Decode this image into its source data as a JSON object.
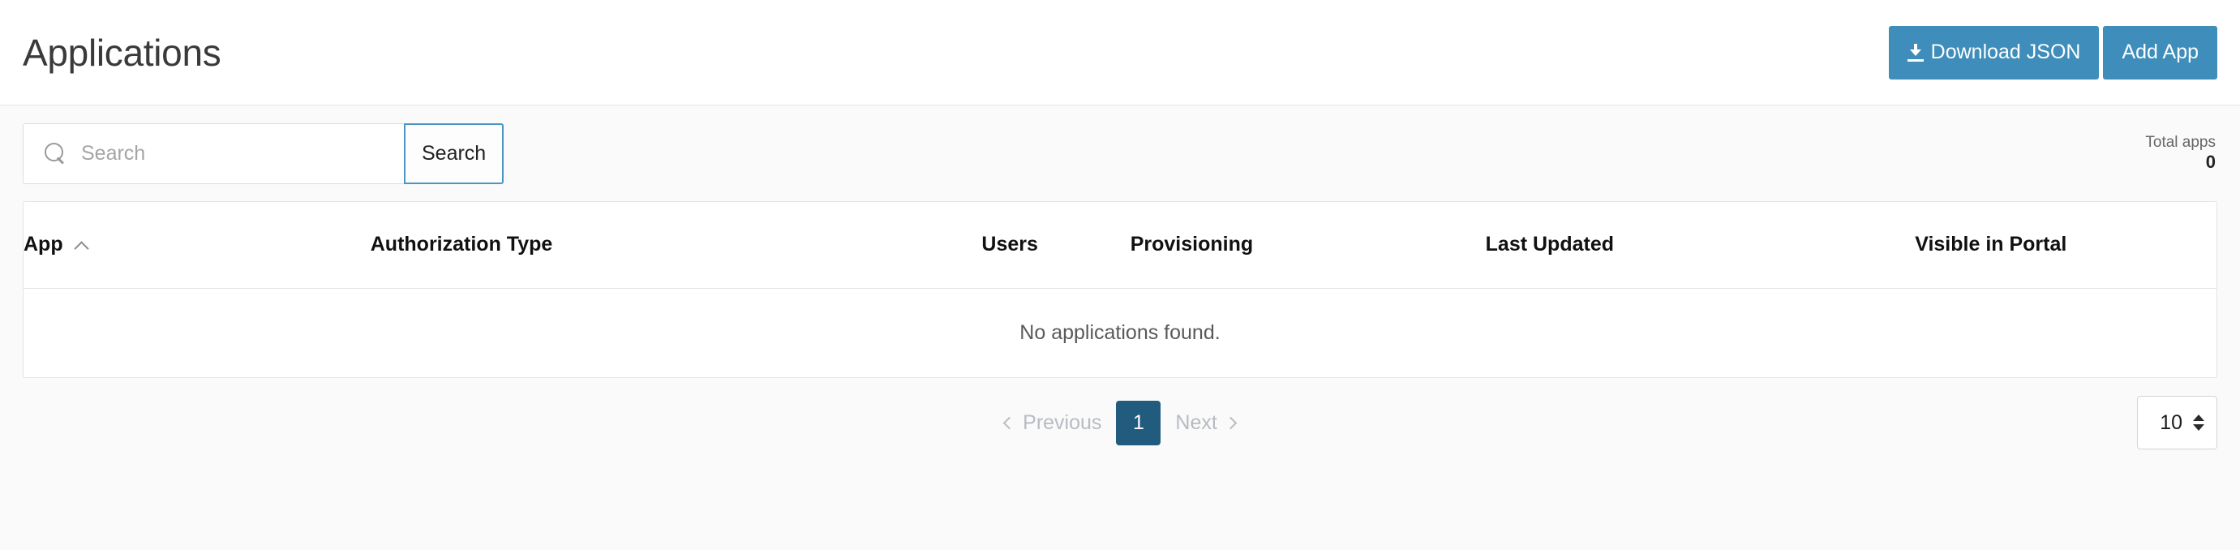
{
  "header": {
    "title": "Applications",
    "download_button": {
      "label": "Download JSON",
      "icon": "download-icon"
    },
    "add_button": {
      "label": "Add App"
    }
  },
  "toolbar": {
    "search": {
      "value": "",
      "placeholder": "Search",
      "icon": "search-icon",
      "button_label": "Search"
    },
    "total_apps": {
      "label": "Total apps",
      "value": "0"
    }
  },
  "table": {
    "columns": [
      {
        "label": "App",
        "sort": "asc",
        "sort_icon": "chevron-up-icon"
      },
      {
        "label": "Authorization Type"
      },
      {
        "label": "Users"
      },
      {
        "label": "Provisioning"
      },
      {
        "label": "Last Updated"
      },
      {
        "label": "Visible in Portal"
      }
    ],
    "rows": [],
    "empty_message": "No applications found."
  },
  "pagination": {
    "previous_label": "Previous",
    "next_label": "Next",
    "pages": [
      "1"
    ],
    "current_page": "1",
    "page_size": "10"
  },
  "colors": {
    "primary_blue": "#3f8dba",
    "active_page_blue": "#215c7e",
    "focus_border": "#4a97c4",
    "body_bg": "#fafafa",
    "muted_text": "#b6bcc2"
  }
}
